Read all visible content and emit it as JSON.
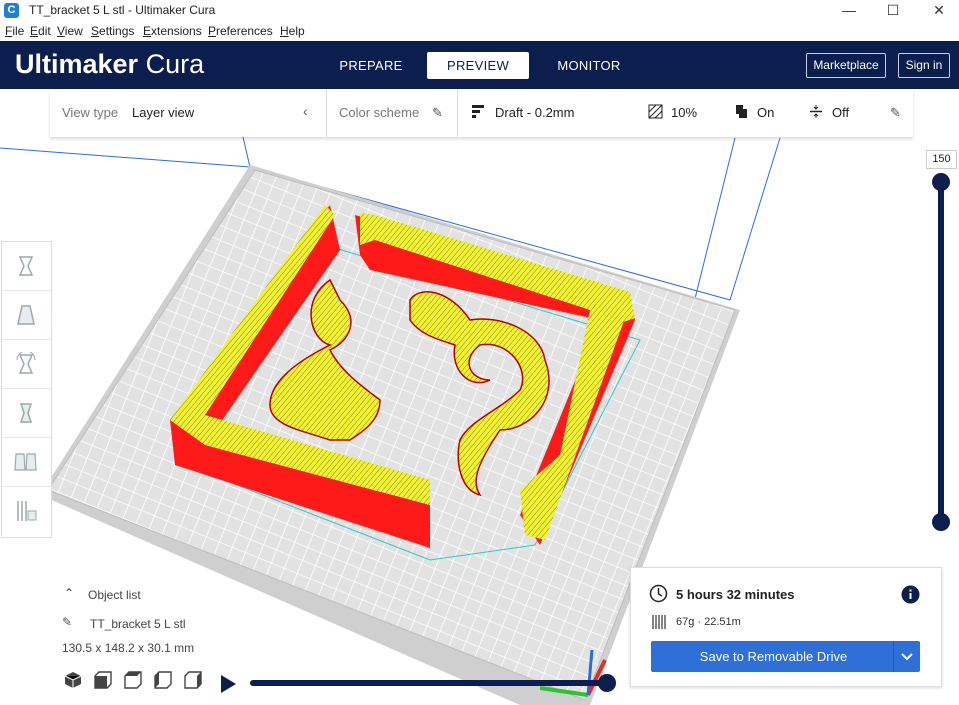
{
  "window": {
    "title": "TT_bracket 5 L stl - Ultimaker Cura",
    "minimize": "—",
    "maximize": "☐",
    "close": "✕"
  },
  "menu": [
    "File",
    "Edit",
    "View",
    "Settings",
    "Extensions",
    "Preferences",
    "Help"
  ],
  "header": {
    "logo_bold": "Ultimaker",
    "logo_light": "Cura",
    "tabs": [
      "PREPARE",
      "PREVIEW",
      "MONITOR"
    ],
    "active_tab": "PREVIEW",
    "marketplace": "Marketplace",
    "sign_in": "Sign in"
  },
  "toolbar": {
    "view_type_label": "View type",
    "view_type_value": "Layer view",
    "color_scheme_label": "Color scheme",
    "profile": "Draft - 0.2mm",
    "infill": "10%",
    "support": "On",
    "adhesion": "Off"
  },
  "layer_slider": {
    "value": "150"
  },
  "object": {
    "list_label": "Object list",
    "name": "TT_bracket 5 L stl",
    "dimensions": "130.5 x 148.2 x 30.1 mm"
  },
  "print_info": {
    "time": "5 hours 32 minutes",
    "material": "67g · 22.51m",
    "button": "Save to Removable Drive"
  },
  "colors": {
    "navy": "#0b1e4d",
    "accent": "#2e6fd8",
    "wall_red": "#ff1a1a",
    "infill_yellow": "#f2f234"
  }
}
